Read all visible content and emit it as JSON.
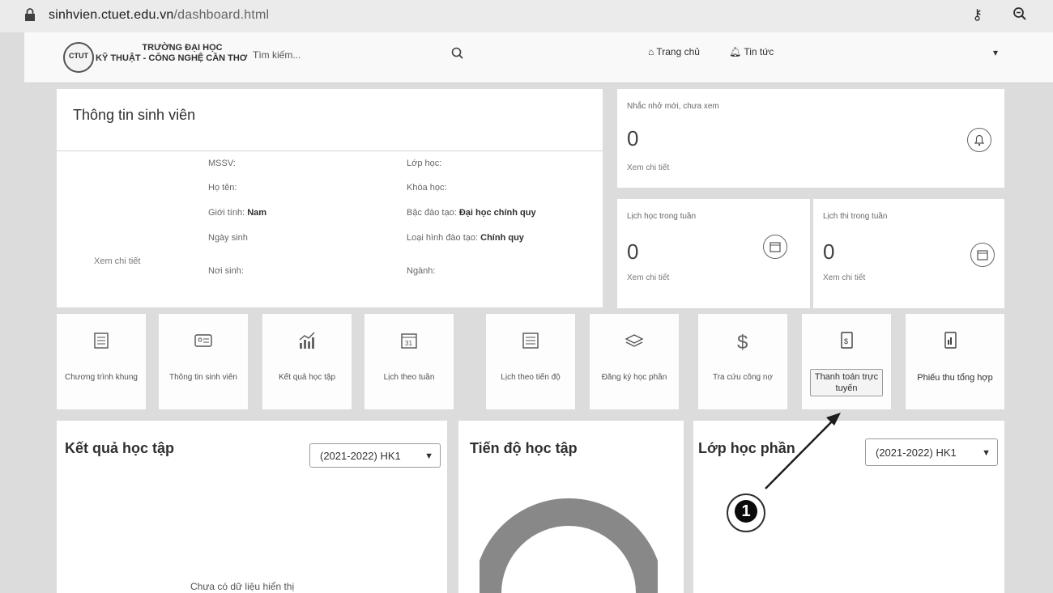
{
  "browser": {
    "url_host": "sinhvien.ctuet.edu.vn",
    "url_path": "/dashboard.html"
  },
  "header": {
    "logo_text": "CTUT",
    "school_line1": "TRƯỜNG ĐẠI HỌC",
    "school_line2": "KỸ THUẬT - CÔNG NGHỆ CẦN THƠ",
    "search_placeholder": "Tìm kiếm...",
    "nav_home": "Trang chủ",
    "nav_news": "Tin tức"
  },
  "student_info": {
    "title": "Thông tin sinh viên",
    "view_detail": "Xem chi tiết",
    "left_fields": [
      {
        "label": "MSSV:",
        "value": ""
      },
      {
        "label": "Họ tên:",
        "value": ""
      },
      {
        "label": "Giới tính:",
        "value": "Nam"
      },
      {
        "label": "Ngày sinh",
        "value": ""
      },
      {
        "label": "Nơi sinh:",
        "value": ""
      }
    ],
    "right_fields": [
      {
        "label": "Lớp học:",
        "value": ""
      },
      {
        "label": "Khóa học:",
        "value": ""
      },
      {
        "label": "Bậc đào tạo:",
        "value": "Đại học chính quy"
      },
      {
        "label": "Loại hình đào tạo:",
        "value": "Chính quy"
      },
      {
        "label": "Ngành:",
        "value": ""
      }
    ]
  },
  "reminder": {
    "label": "Nhắc nhở mới, chưa xem",
    "count": "0",
    "link": "Xem chi tiết"
  },
  "week_schedule": {
    "label": "Lịch học trong tuần",
    "count": "0",
    "link": "Xem chi tiết"
  },
  "exam_schedule": {
    "label": "Lịch thi trong tuần",
    "count": "0",
    "link": "Xem chi tiết"
  },
  "shortcuts": [
    {
      "label": "Chương trình khung",
      "icon": "curriculum-icon"
    },
    {
      "label": "Thông tin sinh viên",
      "icon": "student-card-icon"
    },
    {
      "label": "Kết quả học tập",
      "icon": "chart-icon"
    },
    {
      "label": "Lịch theo tuần",
      "icon": "calendar-icon"
    },
    {
      "label": "Lịch theo tiến độ",
      "icon": "progress-calendar-icon"
    },
    {
      "label": "Đăng ký học phần",
      "icon": "layers-icon"
    },
    {
      "label": "Tra cứu công nợ",
      "icon": "dollar-icon"
    },
    {
      "label": "Thanh toán trực tuyến",
      "icon": "payment-doc-icon"
    },
    {
      "label": "Phiếu thu tổng hợp",
      "icon": "receipt-icon"
    }
  ],
  "results_panel": {
    "title": "Kết quả học tập",
    "semester": "(2021-2022) HK1",
    "empty_text": "Chưa có dữ liệu hiển thị"
  },
  "progress_panel": {
    "title": "Tiến độ học tập"
  },
  "classes_panel": {
    "title": "Lớp học phần",
    "semester": "(2021-2022) HK1"
  },
  "annotation": {
    "number": "1"
  }
}
